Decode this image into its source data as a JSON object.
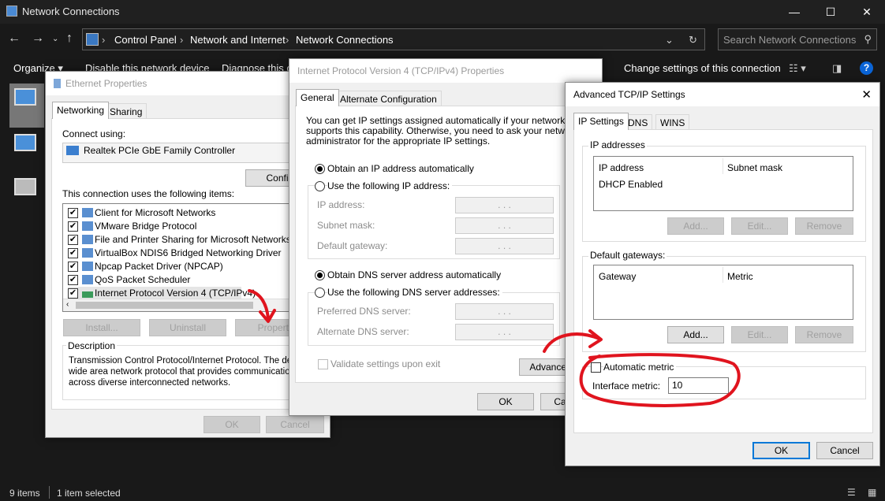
{
  "window": {
    "title": "Network Connections",
    "controls": {
      "minimize": "—",
      "maximize": "☐",
      "close": "✕"
    }
  },
  "address_bar": {
    "breadcrumb": [
      "Control Panel",
      "Network and Internet",
      "Network Connections"
    ],
    "search_placeholder": "Search Network Connections"
  },
  "command_bar": {
    "organize": "Organize ▾",
    "disable": "Disable this network device",
    "diagnose": "Diagnose this c",
    "change_settings": "Change settings of this connection"
  },
  "status_bar": {
    "items": "9 items",
    "selected": "1 item selected"
  },
  "ethernet_props": {
    "title": "Ethernet Properties",
    "tabs": [
      "Networking",
      "Sharing"
    ],
    "connect_using_label": "Connect using:",
    "adapter": "Realtek PCIe GbE Family Controller",
    "configure": "Configure",
    "items_label": "This connection uses the following items:",
    "items": [
      {
        "label": "Client for Microsoft Networks",
        "checked": true
      },
      {
        "label": "VMware Bridge Protocol",
        "checked": true
      },
      {
        "label": "File and Printer Sharing for Microsoft Networks",
        "checked": true
      },
      {
        "label": "VirtualBox NDIS6 Bridged Networking Driver",
        "checked": true
      },
      {
        "label": "Npcap Packet Driver (NPCAP)",
        "checked": true
      },
      {
        "label": "QoS Packet Scheduler",
        "checked": true
      },
      {
        "label": "Internet Protocol Version 4 (TCP/IPv4)",
        "checked": true
      }
    ],
    "install": "Install...",
    "uninstall": "Uninstall",
    "properties": "Properties",
    "description_title": "Description",
    "description": "Transmission Control Protocol/Internet Protocol. The default wide area network protocol that provides communication across diverse interconnected networks.",
    "ok": "OK",
    "cancel": "Cancel"
  },
  "ipv4_props": {
    "title": "Internet Protocol Version 4 (TCP/IPv4) Properties",
    "tabs": [
      "General",
      "Alternate Configuration"
    ],
    "intro": "You can get IP settings assigned automatically if your network supports this capability. Otherwise, you need to ask your network administrator for the appropriate IP settings.",
    "obtain_ip_auto": "Obtain an IP address automatically",
    "use_following_ip": "Use the following IP address:",
    "ip_address": "IP address:",
    "subnet_mask": "Subnet mask:",
    "default_gateway": "Default gateway:",
    "obtain_dns_auto": "Obtain DNS server address automatically",
    "use_following_dns": "Use the following DNS server addresses:",
    "preferred_dns": "Preferred DNS server:",
    "alternate_dns": "Alternate DNS server:",
    "validate": "Validate settings upon exit",
    "advanced": "Advanced...",
    "ok": "OK",
    "cancel": "Cancel",
    "ip_placeholder": ".        .        ."
  },
  "advanced_tcpip": {
    "title": "Advanced TCP/IP Settings",
    "close": "✕",
    "tabs": [
      "IP Settings",
      "DNS",
      "WINS"
    ],
    "ip_addresses_group": "IP addresses",
    "ip_columns": [
      "IP address",
      "Subnet mask"
    ],
    "ip_rows": [
      [
        "DHCP Enabled",
        ""
      ]
    ],
    "gateways_group": "Default gateways:",
    "gateway_columns": [
      "Gateway",
      "Metric"
    ],
    "add": "Add...",
    "edit": "Edit...",
    "remove": "Remove",
    "automatic_metric": "Automatic metric",
    "automatic_metric_checked": false,
    "interface_metric_label": "Interface metric:",
    "interface_metric_value": "10",
    "ok": "OK",
    "cancel": "Cancel"
  },
  "annotations": {
    "color": "#e0141e"
  }
}
